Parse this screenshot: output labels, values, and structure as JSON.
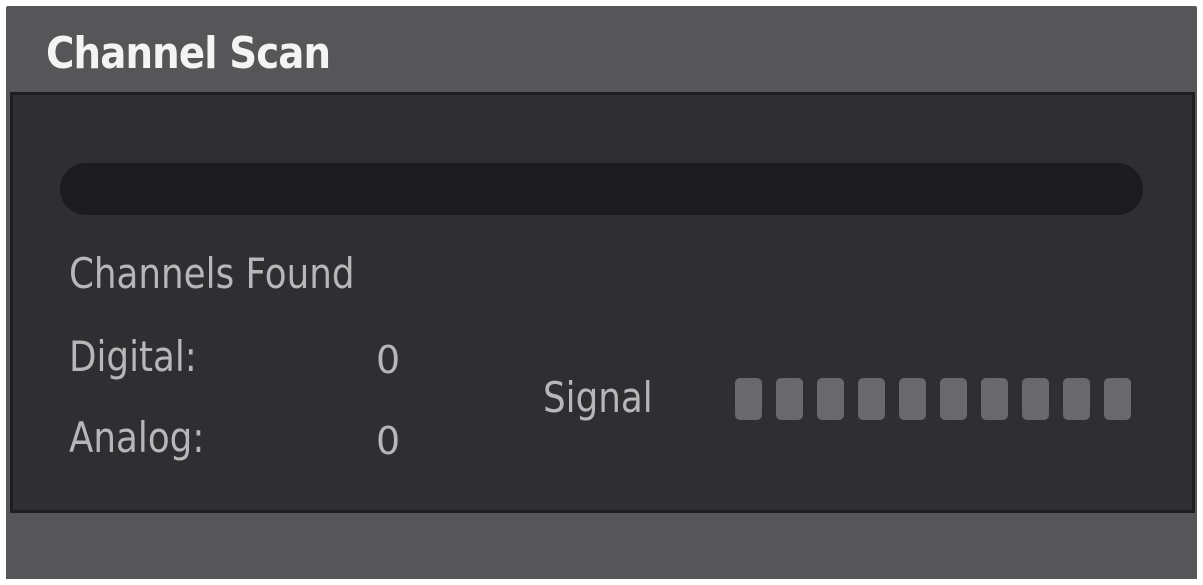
{
  "dialog": {
    "title": "Channel Scan"
  },
  "scan": {
    "progress_fraction": 0,
    "channels_found_label": "Channels Found",
    "digital_label": "Digital:",
    "digital_count": "0",
    "analog_label": "Analog:",
    "analog_count": "0"
  },
  "signal": {
    "label": "Signal",
    "total_bars": 10,
    "active_bars": 0
  },
  "colors": {
    "window": "#565658",
    "panel": "#2f2e31",
    "track": "#1c1b1e",
    "text": "#b7b7b9",
    "bar_inactive": "#69696c"
  }
}
